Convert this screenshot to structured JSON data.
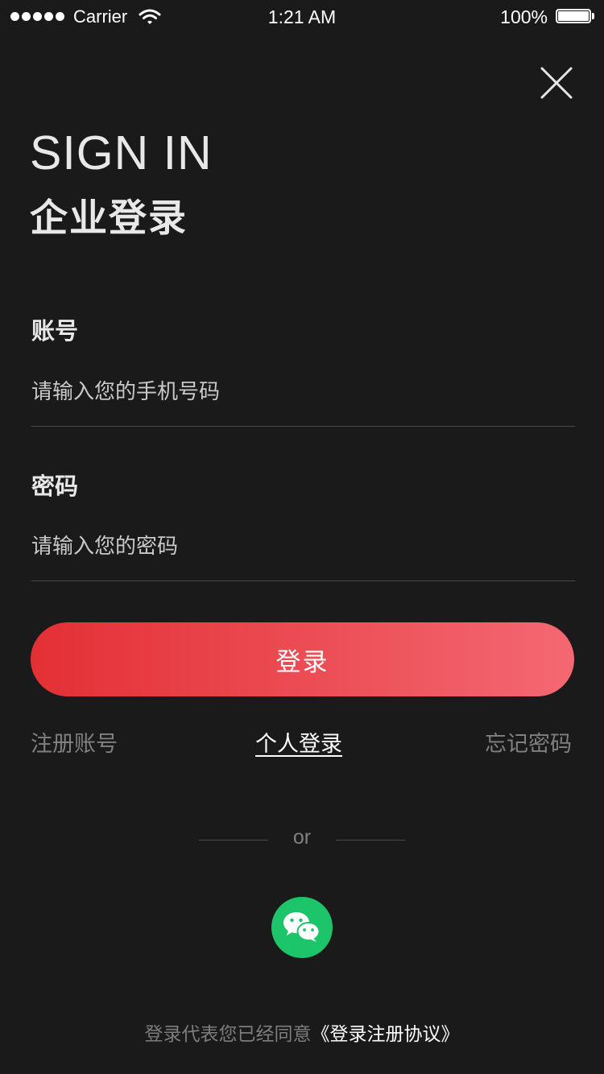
{
  "status_bar": {
    "carrier": "Carrier",
    "time": "1:21 AM",
    "battery": "100%",
    "icons": [
      "signal-dots-icon",
      "wifi-icon",
      "battery-icon"
    ]
  },
  "header": {
    "close_icon": "close-icon",
    "title_en": "SIGN IN",
    "title_cn": "企业登录"
  },
  "form": {
    "account_label": "账号",
    "account_placeholder": "请输入您的手机号码",
    "password_label": "密码",
    "password_placeholder": "请输入您的密码"
  },
  "login_button": "登录",
  "links": {
    "register": "注册账号",
    "personal_login": "个人登录",
    "forgot_password": "忘记密码"
  },
  "divider": "or",
  "social": {
    "wechat_icon": "wechat-icon",
    "color": "#1cc569"
  },
  "agreement": {
    "prefix": "登录代表您已经同意",
    "link": "《登录注册协议》"
  },
  "colors": {
    "background": "#1a1a1b",
    "accent_start": "#e33035",
    "accent_end": "#f46872"
  }
}
